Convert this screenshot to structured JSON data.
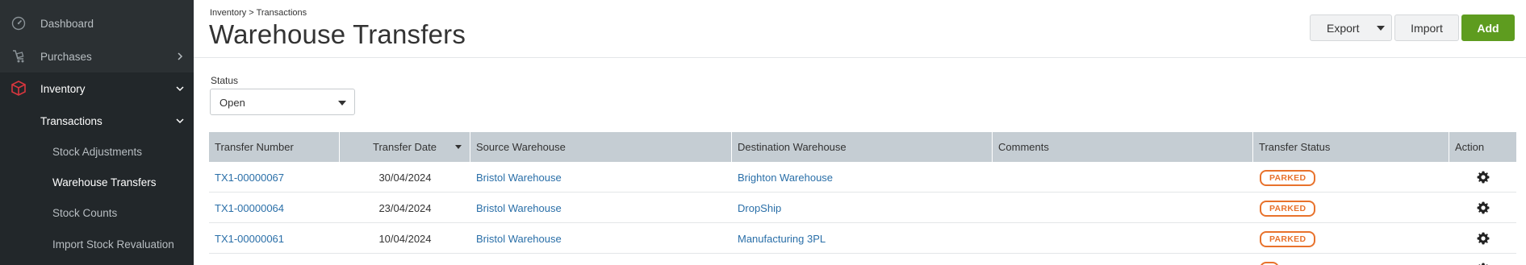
{
  "sidebar": {
    "items": [
      {
        "label": "Dashboard",
        "icon": "dashboard-icon"
      },
      {
        "label": "Purchases",
        "icon": "cart-icon"
      },
      {
        "label": "Inventory",
        "icon": "box-icon"
      },
      {
        "label": "Transactions"
      },
      {
        "label": "Stock Adjustments"
      },
      {
        "label": "Warehouse Transfers"
      },
      {
        "label": "Stock Counts"
      },
      {
        "label": "Import Stock Revaluation"
      }
    ]
  },
  "header": {
    "breadcrumb": "Inventory > Transactions",
    "title": "Warehouse Transfers",
    "export_label": "Export",
    "import_label": "Import",
    "add_label": "Add"
  },
  "filter": {
    "status_label": "Status",
    "status_value": "Open"
  },
  "table": {
    "columns": [
      "Transfer Number",
      "Transfer Date",
      "Source Warehouse",
      "Destination Warehouse",
      "Comments",
      "Transfer Status",
      "Action"
    ],
    "rows": [
      {
        "number": "TX1-00000067",
        "date": "30/04/2024",
        "source": "Bristol Warehouse",
        "destination": "Brighton Warehouse",
        "comments": "",
        "status": "PARKED"
      },
      {
        "number": "TX1-00000064",
        "date": "23/04/2024",
        "source": "Bristol Warehouse",
        "destination": "DropShip",
        "comments": "",
        "status": "PARKED"
      },
      {
        "number": "TX1-00000061",
        "date": "10/04/2024",
        "source": "Bristol Warehouse",
        "destination": "Manufacturing 3PL",
        "comments": "",
        "status": "PARKED"
      }
    ]
  },
  "colors": {
    "sidebar_bg": "#2b3033",
    "accent_green": "#5e9c1f",
    "link_blue": "#2a6fa8",
    "parked_orange": "#e8722c",
    "inventory_icon_red": "#d9363e"
  }
}
